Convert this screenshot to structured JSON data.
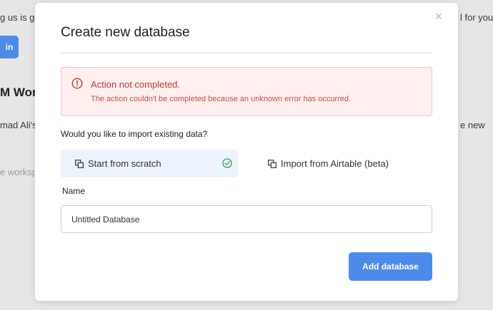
{
  "background": {
    "text_line_1_left": "g us is gr",
    "text_line_1_right": "l for you.",
    "button_label": "in",
    "heading_fragment": "M Wor",
    "text_line_2_left": "mad Ali's c",
    "text_line_2_right": "e new",
    "muted_fragment": "e worksp"
  },
  "modal": {
    "title": "Create new database",
    "close_glyph": "×",
    "alert": {
      "title": "Action not completed.",
      "description": "The action couldn't be completed because an unknown error has occurred."
    },
    "import_question": "Would you like to import existing data?",
    "options": [
      {
        "label": "Start from scratch",
        "selected": true
      },
      {
        "label": "Import from Airtable (beta)",
        "selected": false
      }
    ],
    "name_label": "Name",
    "name_value": "Untitled Database",
    "submit_label": "Add database"
  },
  "colors": {
    "primary": "#4d8bea",
    "error_bg": "#fff0ef",
    "error_text": "#c0392b",
    "selected_bg": "#edf3fc",
    "success": "#2ea44f"
  }
}
